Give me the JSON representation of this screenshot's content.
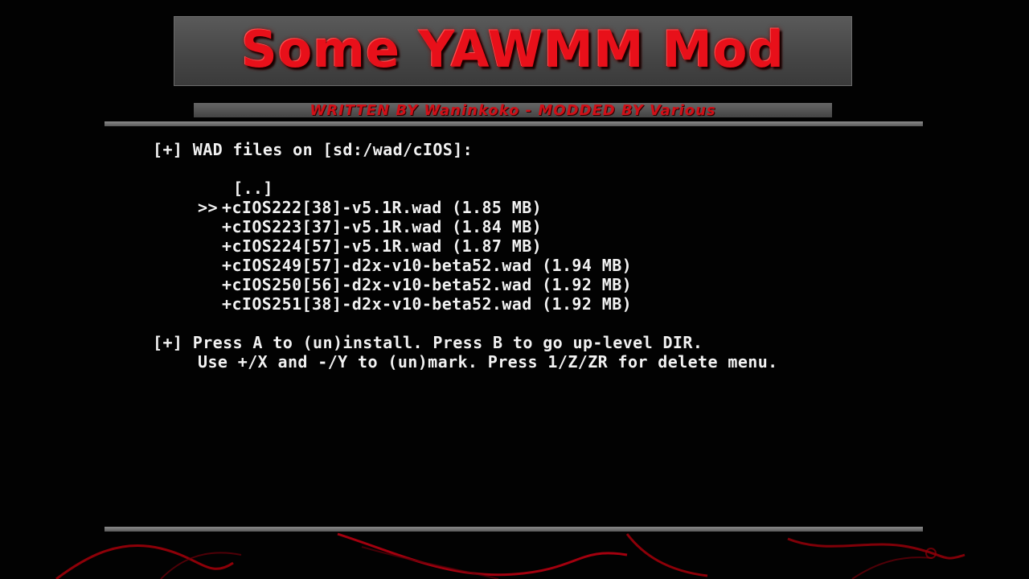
{
  "banner": {
    "title": "Some YAWMM Mod",
    "subtitle": "WRITTEN BY Waninkoko - MODDED BY Various"
  },
  "browser": {
    "header": "[+] WAD files on [sd:/wad/cIOS]:",
    "parent_dir": "[..]",
    "cursor": ">>",
    "files": [
      "+cIOS222[38]-v5.1R.wad (1.85 MB)",
      "+cIOS223[37]-v5.1R.wad (1.84 MB)",
      "+cIOS224[57]-v5.1R.wad (1.87 MB)",
      "+cIOS249[57]-d2x-v10-beta52.wad (1.94 MB)",
      "+cIOS250[56]-d2x-v10-beta52.wad (1.92 MB)",
      "+cIOS251[38]-d2x-v10-beta52.wad (1.92 MB)"
    ],
    "selected_index": 0
  },
  "help": {
    "line1": "[+] Press A to (un)install. Press B to go up-level DIR.",
    "line2": "Use +/X and -/Y to (un)mark. Press 1/Z/ZR for delete menu."
  },
  "colors": {
    "background": "#020202",
    "text": "#f2f2f2",
    "accent_red": "#e8101a",
    "banner_gray": "#4a4a4a"
  }
}
